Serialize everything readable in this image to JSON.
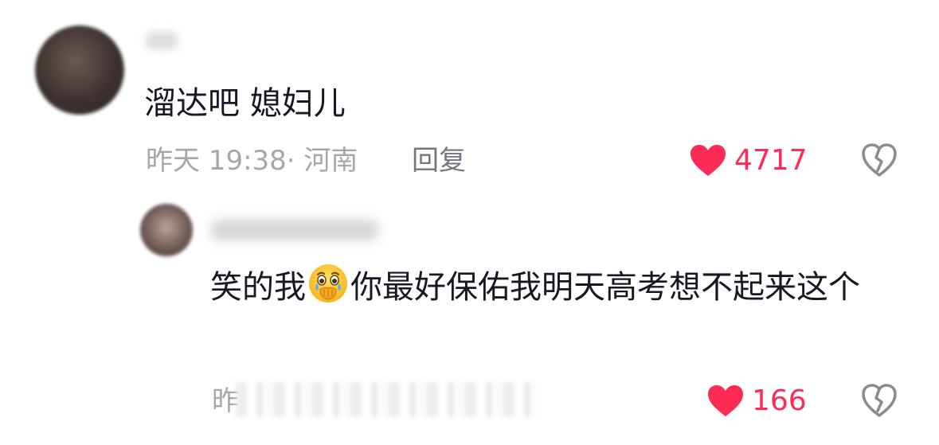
{
  "comment": {
    "text": "溜达吧 媳妇儿",
    "timestamp_location": "昨天 19:38· 河南",
    "reply_label": "回复",
    "like_count": "4717",
    "like_color": "#fe2c55",
    "icons": [
      "heart-icon",
      "broken-heart-icon"
    ]
  },
  "reply": {
    "text_before": "笑的我",
    "emoji": "crying-emoji",
    "text_after": "你最好保佑我明天高考想不起来这个",
    "timestamp_partial": "昨",
    "like_count": "166",
    "icons": [
      "heart-icon",
      "broken-heart-icon"
    ]
  }
}
